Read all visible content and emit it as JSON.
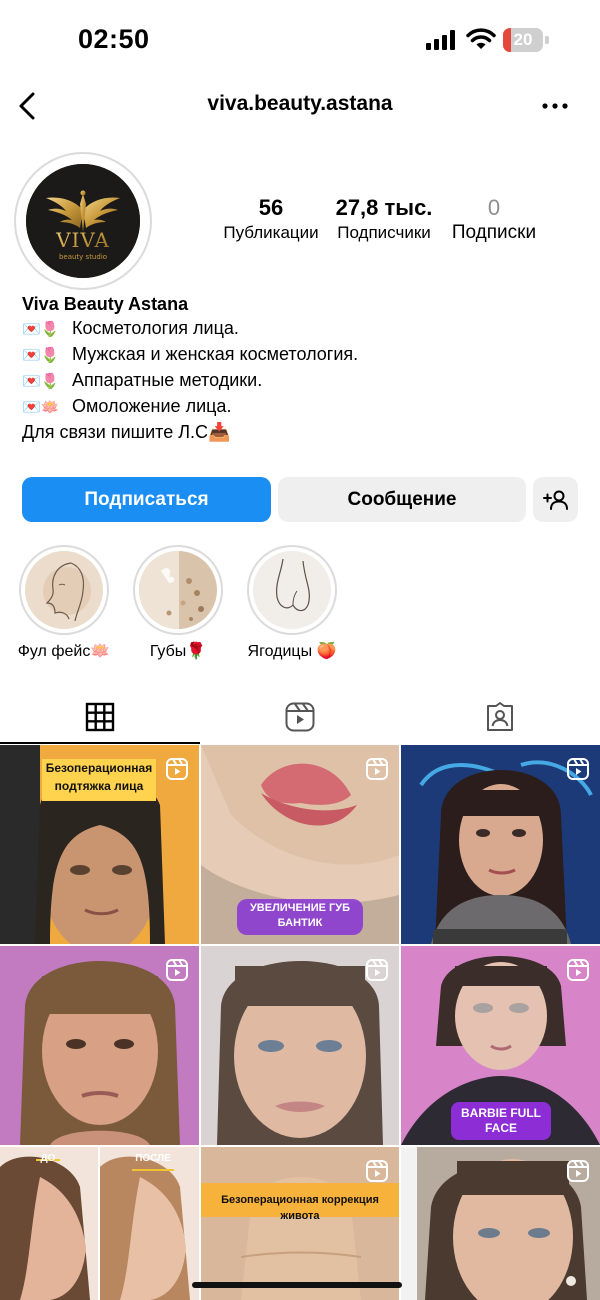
{
  "status": {
    "time": "02:50",
    "battery": "20",
    "battery_level": 0.2
  },
  "nav": {
    "title": "viva.beauty.astana",
    "back_icon": "chevron-left-icon",
    "more_icon": "more-horizontal-icon"
  },
  "avatar": {
    "brand": "VIVA",
    "tagline": "beauty studio"
  },
  "stats": [
    {
      "value": "56",
      "label": "Публикации"
    },
    {
      "value": "27,8 тыс.",
      "label": "Подписчики"
    },
    {
      "value": "0",
      "label": "Подписки"
    }
  ],
  "bio": {
    "name": "Viva Beauty Astana",
    "lines": [
      {
        "emoji": "💌🌷",
        "text": "Косметология лица."
      },
      {
        "emoji": "💌🌷",
        "text": "Мужская и женская косметология."
      },
      {
        "emoji": "💌🌷",
        "text": "Аппаратные методики."
      },
      {
        "emoji": "💌🪷",
        "text": "Омоложение лица."
      }
    ],
    "contact": "Для связи пишите Л.С📥"
  },
  "buttons": {
    "follow": "Подписаться",
    "message": "Сообщение",
    "add_icon": "add-person-icon"
  },
  "highlights": [
    {
      "label": "Фул фейс🪷"
    },
    {
      "label": "Губы🌹"
    },
    {
      "label": "Ягодицы 🍑"
    }
  ],
  "tabs": [
    {
      "icon": "grid-icon",
      "active": true
    },
    {
      "icon": "reels-icon",
      "active": false
    },
    {
      "icon": "tagged-icon",
      "active": false
    }
  ],
  "posts": [
    {
      "overlay": "Безоперационная подтяжка лица",
      "reel": true
    },
    {
      "overlay": "УВЕЛИЧЕНИЕ ГУБ БАНТИК",
      "reel": true
    },
    {
      "overlay": "",
      "reel": true
    },
    {
      "overlay": "",
      "reel": true
    },
    {
      "overlay": "",
      "reel": true
    },
    {
      "overlay": "BARBIE FULL FACE",
      "reel": true
    },
    {
      "overlay": "ДО",
      "overlay2": "ПОСЛЕ",
      "reel": false
    },
    {
      "overlay": "Безоперационная коррекция живота",
      "reel": true
    },
    {
      "overlay": "",
      "reel": true
    }
  ],
  "colors": {
    "primary": "#1a8ef3",
    "secondary_button": "#efefef",
    "battery_low": "#e5483b"
  }
}
